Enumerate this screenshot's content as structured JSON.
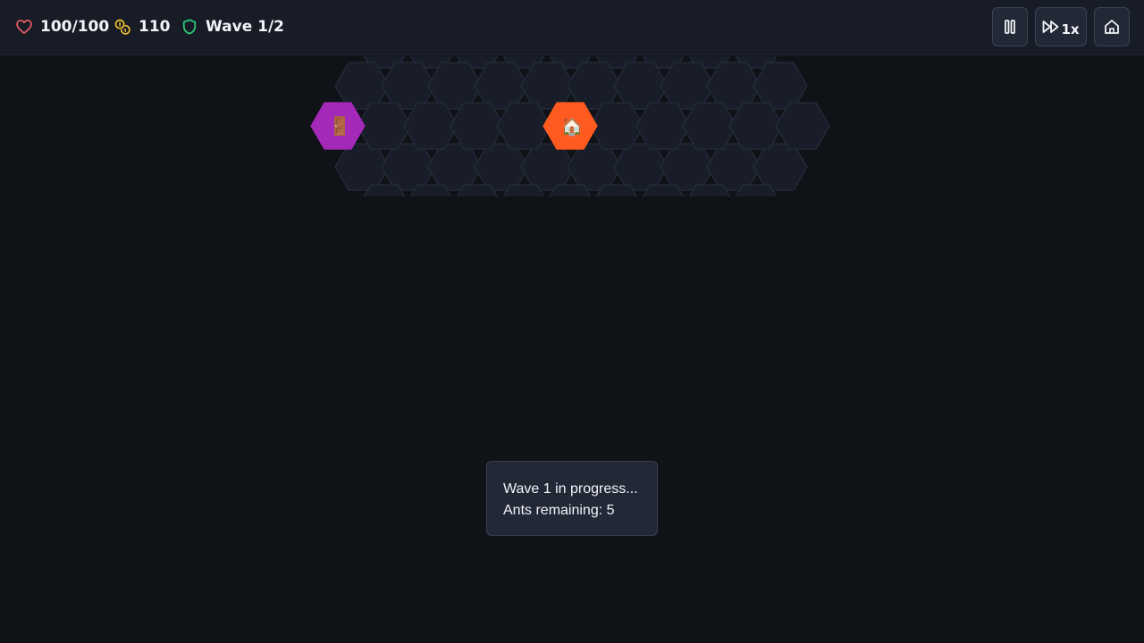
{
  "hud": {
    "health": "100/100",
    "coins": "110",
    "wave": "Wave 1/2"
  },
  "controls": {
    "speed_label": "1x"
  },
  "icons": {
    "health": "heart-icon",
    "coins": "coins-icon",
    "wave": "shield-icon",
    "pause": "pause-icon",
    "speed": "fast-forward-icon",
    "home": "home-icon",
    "spawn": "door-icon",
    "base": "house-icon"
  },
  "board": {
    "spawn_glyph": "🚪",
    "base_glyph": "🏠"
  },
  "status": {
    "line1": "Wave 1 in progress...",
    "line2": "Ants remaining: 5"
  },
  "colors": {
    "background": "#0f1216",
    "topbar": "#171c27",
    "hex_fill": "#181d29",
    "hex_stroke": "#262d3b",
    "spawn": "#a329b8",
    "base": "#ff5a1f",
    "health_icon": "#f25c6b",
    "coins_icon": "#f2c230",
    "wave_icon": "#2fd07b"
  }
}
